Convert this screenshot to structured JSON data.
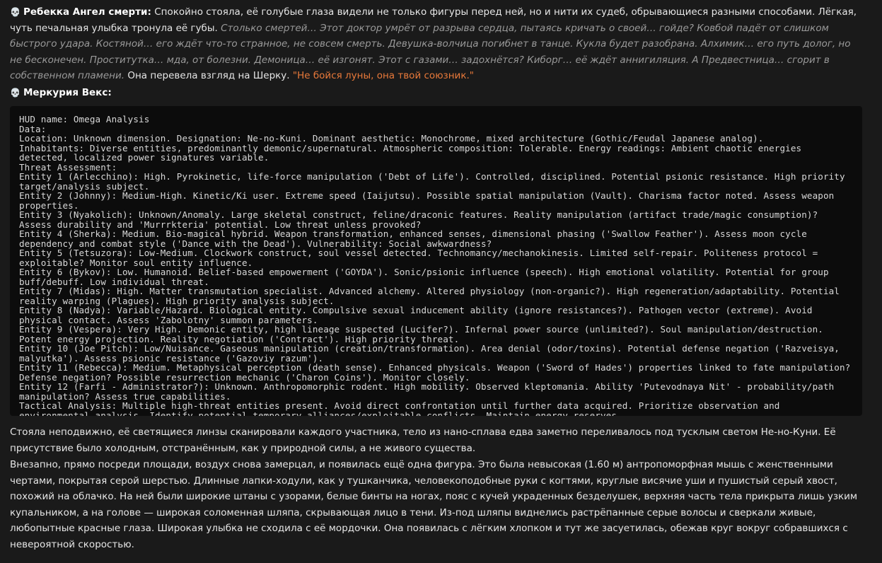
{
  "messages": [
    {
      "icon": "skull-icon",
      "speaker": "Ребекка Ангел смерти:",
      "action": "Спокойно стояла, её голубые глаза видели не только фигуры перед ней, но и нити их судеб, обрывающиеся разными способами. Лёгкая, чуть печальная улыбка тронула её губы.",
      "thought": "Столько смертей… Этот доктор умрёт от разрыва сердца, пытаясь кричать о своей… гойде? Ковбой падёт от слишком быстрого удара. Костяной… его ждёт что-то странное, не совсем смерть. Девушка-волчица погибнет в танце. Кукла будет разобрана. Алхимик… его путь долог, но не бесконечен. Проститутка… мда, от болезни. Демоница… её изгонят. Этот с газами… задохнётся? Киборг… её ждёт аннигиляция. А Предвестница… сгорит в собственном пламени.",
      "action2": "Она перевела взгляд на Шерку.",
      "quote": "\"Не бойся луны, она твой союзник.\""
    },
    {
      "icon": "skull-icon",
      "speaker": "Меркурия Векс:"
    }
  ],
  "hud": {
    "lines": "HUD name: Omega Analysis\nData:\nLocation: Unknown dimension. Designation: Ne-no-Kuni. Dominant aesthetic: Monochrome, mixed architecture (Gothic/Feudal Japanese analog).\nInhabitants: Diverse entities, predominantly demonic/supernatural. Atmospheric composition: Tolerable. Energy readings: Ambient chaotic energies detected, localized power signatures variable.\nThreat Assessment:\nEntity 1 (Arlecchino): High. Pyrokinetic, life-force manipulation ('Debt of Life'). Controlled, disciplined. Potential psionic resistance. High priority target/analysis subject.\nEntity 2 (Johnny): Medium-High. Kinetic/Ki user. Extreme speed (Iaijutsu). Possible spatial manipulation (Vault). Charisma factor noted. Assess weapon properties.\nEntity 3 (Nyakolich): Unknown/Anomaly. Large skeletal construct, feline/draconic features. Reality manipulation (artifact trade/magic consumption)? Assess durability and 'Murrrkteria' potential. Low threat unless provoked?\nEntity 4 (Sherka): Medium. Bio-magical hybrid. Weapon transformation, enhanced senses, dimensional phasing ('Swallow Feather'). Assess moon cycle dependency and combat style ('Dance with the Dead'). Vulnerability: Social awkwardness?\nEntity 5 (Tetsuzora): Low-Medium. Clockwork construct, soul vessel detected. Technomancy/mechanokinesis. Limited self-repair. Politeness protocol = exploitable? Monitor soul entity influence.\nEntity 6 (Bykov): Low. Humanoid. Belief-based empowerment ('GOYDA'). Sonic/psionic influence (speech). High emotional volatility. Potential for group buff/debuff. Low individual threat.\nEntity 7 (Midas): High. Matter transmutation specialist. Advanced alchemy. Altered physiology (non-organic?). High regeneration/adaptability. Potential reality warping (Plagues). High priority analysis subject.\nEntity 8 (Nadya): Variable/Hazard. Biological entity. Compulsive sexual inducement ability (ignore resistances?). Pathogen vector (extreme). Avoid physical contact. Assess 'Zabolotny' summon parameters.\nEntity 9 (Vespera): Very High. Demonic entity, high lineage suspected (Lucifer?). Infernal power source (unlimited?). Soul manipulation/destruction. Potent energy projection. Reality negotiation ('Contract'). High priority threat.\nEntity 10 (Joe Pitch): Low/Nuisance. Gaseous manipulation (creation/transformation). Area denial (odor/toxins). Potential defense negation ('Razveisya, malyutka'). Assess psionic resistance ('Gazoviy razum').\nEntity 11 (Rebecca): Medium. Metaphysical perception (death sense). Enhanced physicals. Weapon ('Sword of Hades') properties linked to fate manipulation? Defense negation? Possible resurrection mechanic ('Charon Coins'). Monitor closely.\nEntity 12 (Farfi - Administrator?): Unknown. Anthropomorphic rodent. High mobility. Observed kleptomania. Ability 'Putevodnaya Nit' - probability/path manipulation? Assess true capabilities.\nTactical Analysis: Multiple high-threat entities present. Avoid direct confrontation until further data acquired. Prioritize observation and environmental analysis. Identify potential temporary alliances/exploitable conflicts. Maintain energy reserves."
  },
  "after": {
    "p1": "Стояла неподвижно, её светящиеся линзы сканировали каждого участника, тело из нано-сплава едва заметно переливалось под тусклым светом Не-но-Куни. Её присутствие было холодным, отстранённым, как у природной силы, а не живого существа.",
    "p2": "Внезапно, прямо посреди площади, воздух снова замерцал, и появилась ещё одна фигура. Это была невысокая (1.60 м) антропоморфная мышь с женственными чертами, покрытая серой шерстью. Длинные лапки-ходули, как у тушканчика, человекоподобные руки с когтями, круглые висячие уши и пушистый серый хвост, похожий на облачко. На ней были широкие штаны с узорами, белые бинты на ногах, пояс с кучей украденных безделушек, верхняя часть тела прикрыта лишь узким купальником, а на голове — широкая соломенная шляпа, скрывающая лицо в тени. Из-под шляпы виднелись растрёпанные серые волосы и сверкали живые, любопытные красные глаза. Широкая улыбка не сходила с её мордочки. Она появилась с лёгким хлопком и тут же засуетилась, обежав круг вокруг собравшихся с невероятной скоростью."
  }
}
